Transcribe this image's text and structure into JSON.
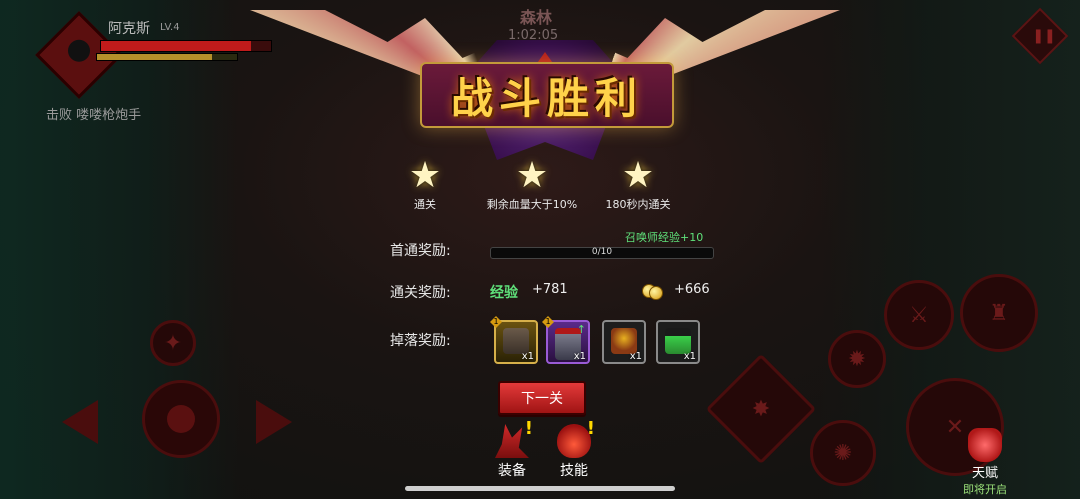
{
  "hud": {
    "player_name": "阿克斯",
    "player_level": "LV.4",
    "hp_fraction": 0.88,
    "mp_fraction": 0.82,
    "defeat_message": "击败 喽喽枪炮手",
    "enemy_name": "森林",
    "enemy_timer": "1:02:05"
  },
  "victory": {
    "title": "战斗胜利",
    "stars": [
      {
        "condition": "通关"
      },
      {
        "condition": "剩余血量大于10%"
      },
      {
        "condition": "180秒内通关"
      }
    ]
  },
  "rewards": {
    "first_clear_label": "首通奖励:",
    "summoner_exp_text": "召唤师经验+10",
    "progress_text": "0/10",
    "progress_fraction": 0.0,
    "clear_label": "通关奖励:",
    "exp_label": "经验",
    "exp_value": "+781",
    "gold_value": "+666",
    "drop_label": "掉落奖励:",
    "drops": [
      {
        "name": "armor",
        "qty": "x1",
        "level": "1"
      },
      {
        "name": "helmet",
        "qty": "x1",
        "level": "1",
        "upgrade": "↑"
      },
      {
        "name": "coin-pot",
        "qty": "x1"
      },
      {
        "name": "potion",
        "qty": "x1"
      }
    ]
  },
  "buttons": {
    "next_level": "下一关",
    "equipment": "装备",
    "skills": "技能",
    "talent": "天赋",
    "talent_sub": "即将开启",
    "alert_mark": "!"
  },
  "colors": {
    "accent_gold": "#ffd24a",
    "victory_green": "#5fe07a",
    "button_red": "#e33a3a"
  }
}
